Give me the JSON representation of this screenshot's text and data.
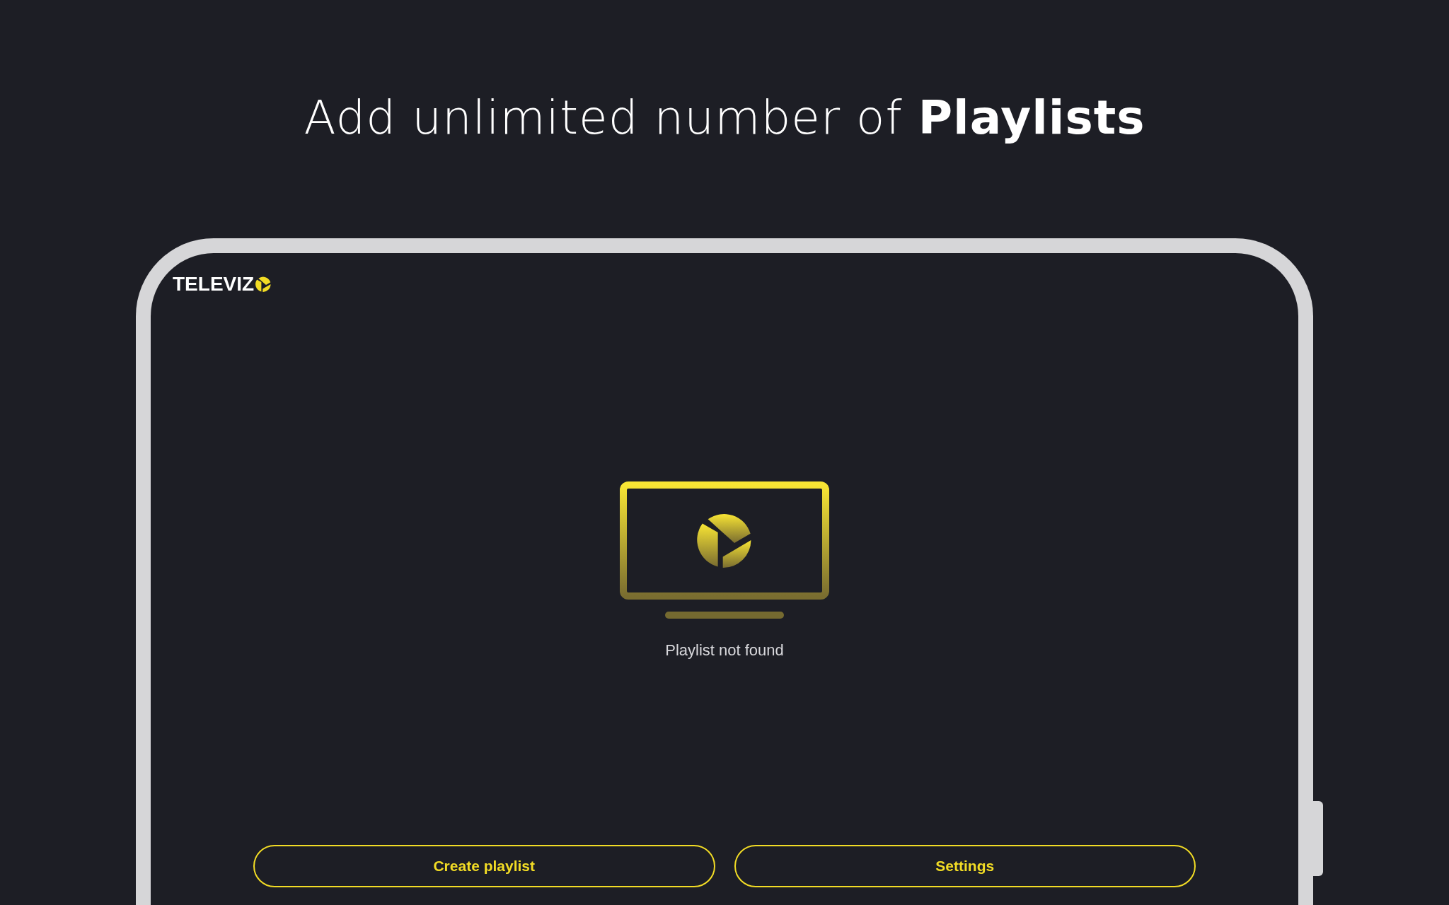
{
  "headline": "Add unlimited number of **Playlists**",
  "app": {
    "logo": "TELEVIZ",
    "empty_state": {
      "message": "Playlist not found"
    },
    "buttons": [
      {
        "label": "Create playlist"
      },
      {
        "label": "Settings"
      }
    ]
  }
}
